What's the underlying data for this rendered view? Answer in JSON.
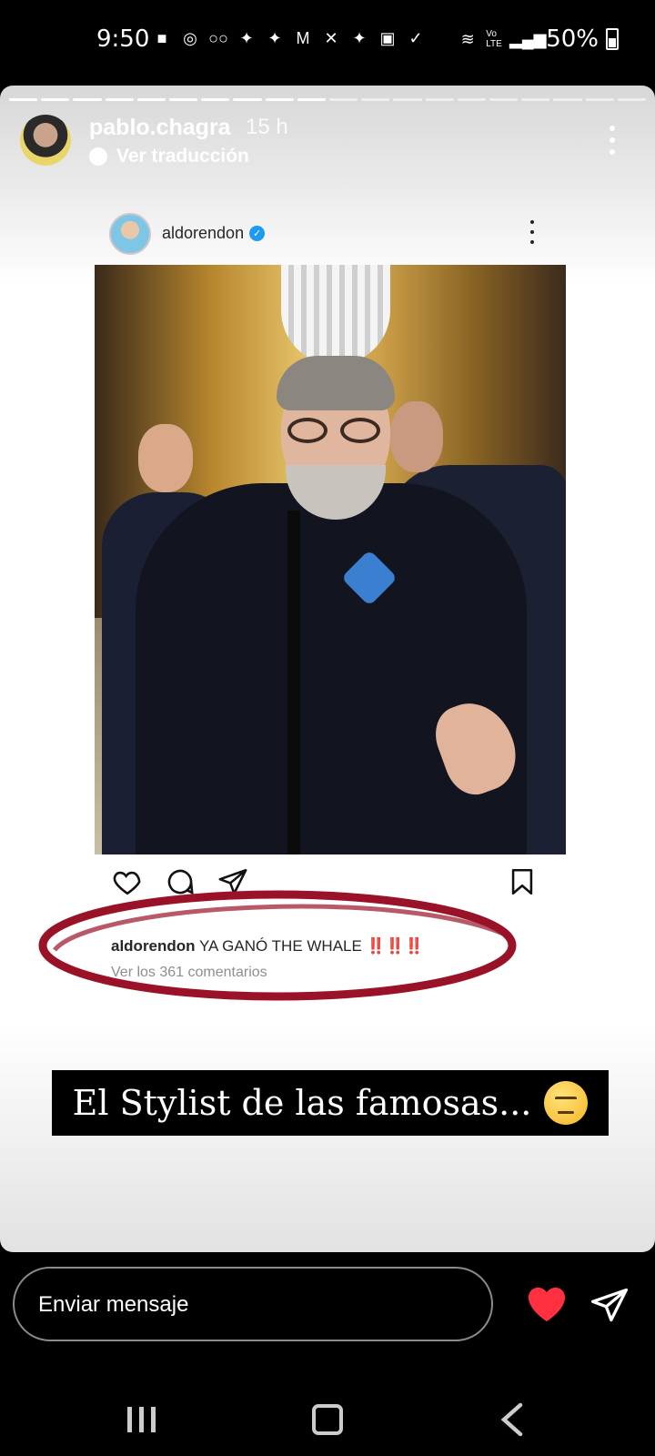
{
  "status_bar": {
    "time": "9:50",
    "battery": "50%",
    "network": "Vo LTE"
  },
  "story": {
    "username": "pablo.chagra",
    "time_ago": "15 h",
    "translate_label": "Ver traducción",
    "progress": {
      "total_segments": 20,
      "viewed_segments": 10
    },
    "post": {
      "username": "aldorendon",
      "caption_user": "aldorendon",
      "caption_text": "YA GANÓ THE WHALE",
      "caption_emphasis": "‼️‼️‼️",
      "comments_link": "Ver los 361 comentarios"
    },
    "overlay_text": "El Stylist de las famosas...",
    "overlay_emoji": "unamused-face"
  },
  "reply_bar": {
    "placeholder": "Enviar mensaje"
  },
  "colors": {
    "accent_red": "#c0111f",
    "verified_blue": "#1d9bf0",
    "heart": "#ff3040"
  }
}
